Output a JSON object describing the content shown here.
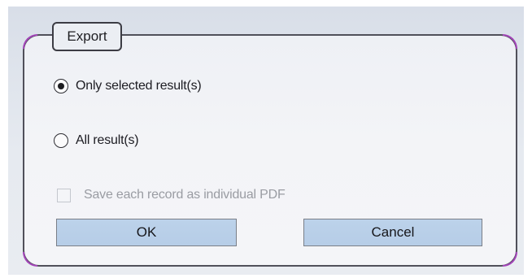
{
  "dialog": {
    "group_title": "Export",
    "options": [
      {
        "label": "Only selected result(s)",
        "selected": true
      },
      {
        "label": "All result(s)",
        "selected": false
      }
    ],
    "checkbox": {
      "label": "Save each record as individual PDF",
      "checked": false,
      "enabled": false
    },
    "buttons": {
      "ok_label": "OK",
      "cancel_label": "Cancel"
    }
  },
  "colors": {
    "frame_border": "#50505a",
    "corner_accent": "#a244b8",
    "button_fill": "#bcd2ea",
    "disabled_text": "#9a9ca3"
  },
  "icons": {
    "radio_selected": "radio-selected-icon",
    "radio_unselected": "radio-unselected-icon",
    "checkbox_unchecked": "checkbox-unchecked-icon"
  }
}
